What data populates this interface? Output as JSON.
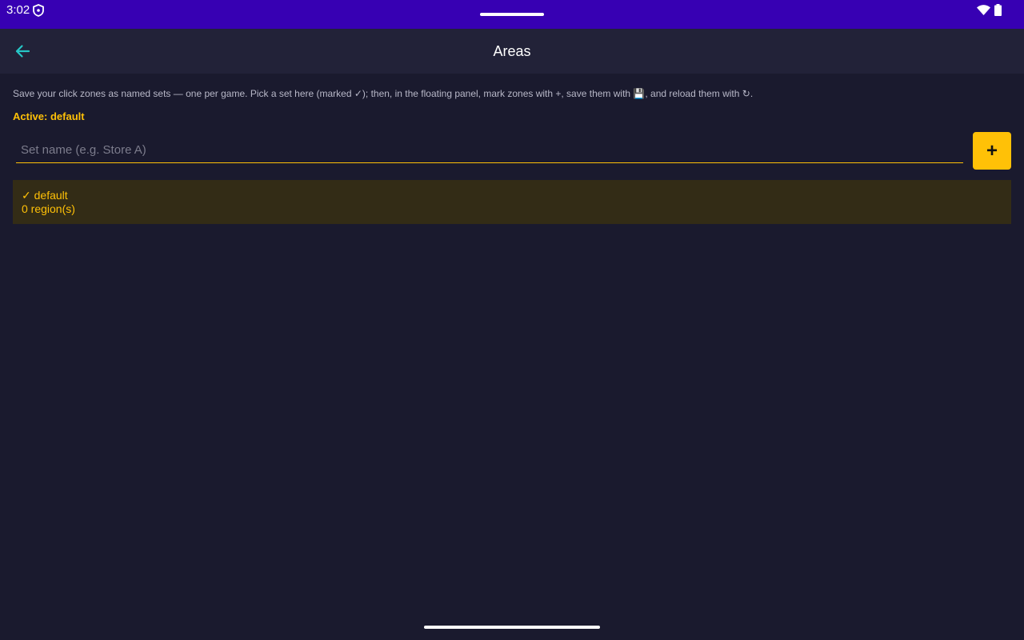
{
  "status_bar": {
    "time": "3:02",
    "icons": [
      "shield-icon",
      "wifi-icon",
      "battery-icon"
    ]
  },
  "app_bar": {
    "title": "Areas",
    "back_icon": "arrow-left-icon"
  },
  "description": "Save your click zones as named sets — one per game. Pick a set here (marked ✓); then, in the floating panel, mark zones with +, save them with 💾, and reload them with ↻.",
  "active_label": "Active: default",
  "set_name_input": {
    "value": "",
    "placeholder": "Set name (e.g. Store A)"
  },
  "add_button": {
    "label": "+"
  },
  "sets": [
    {
      "name": "✓ default",
      "count": "0 region(s)",
      "active": true
    }
  ],
  "colors": {
    "status_bar": "#3700b3",
    "app_bar": "#222238",
    "background": "#1a1a2e",
    "accent": "#ffc107",
    "back_arrow": "#26c6c6",
    "selected_item": "#332c16"
  }
}
